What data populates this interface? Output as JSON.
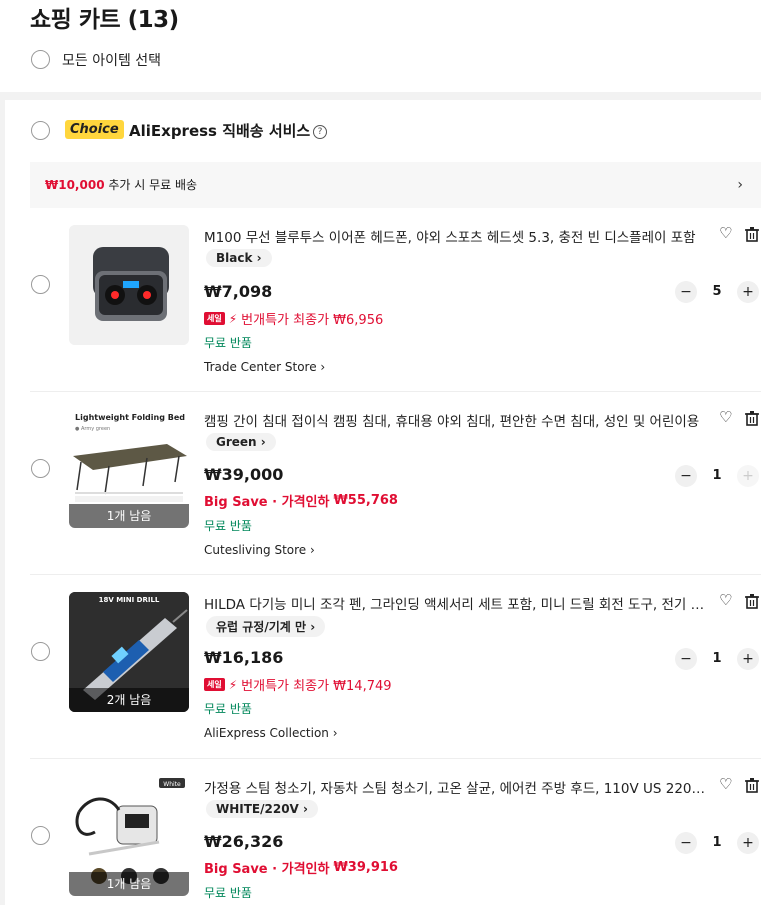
{
  "header": {
    "title": "쇼핑 카트 (13)",
    "select_all_label": "모든 아이템 선택"
  },
  "store": {
    "choice_badge": "Choice",
    "title": "AliExpress 직배송 서비스",
    "info_icon": "?",
    "shipping_amount": "₩10,000",
    "shipping_text": " 추가 시 무료 배송",
    "shipping_chevron": "›"
  },
  "items": [
    {
      "title": "M100 무선 블루투스 이어폰 헤드폰, 야외 스포츠 헤드셋 5.3, 충전 빈 디스플레이 포함",
      "variant": "Black ›",
      "price": "₩7,098",
      "promo_tag": "세일",
      "promo_text": "번개특가 최종가 ",
      "promo_price": "₩6,956",
      "free_return": "무료 반품",
      "store": "Trade Center Store ›",
      "qty": "5",
      "remaining": ""
    },
    {
      "title": "캠핑 간이 침대 접이식 캠핑 침대, 휴대용 야외 침대, 편안한 수면 침대, 성인 및 어린이용",
      "variant": "Green ›",
      "price": "₩39,000",
      "promo_text": "Big Save · 가격인하 ",
      "promo_price": "₩55,768",
      "free_return": "무료 반품",
      "store": "Cutesliving Store ›",
      "qty": "1",
      "remaining": "1개 남음",
      "thumb_caption": "Lightweight Folding Bed",
      "thumb_sub": "● Army green"
    },
    {
      "title": "HILDA 다기능 미니 조각 펜, 그라인딩 액세서리 세트 포함, 미니 드릴 회전 도구, 전기 조각기",
      "variant": "유럽 규정/기계 만 ›",
      "price": "₩16,186",
      "promo_tag": "세일",
      "promo_text": "번개특가 최종가 ",
      "promo_price": "₩14,749",
      "free_return": "무료 반품",
      "store": "AliExpress Collection ›",
      "qty": "1",
      "remaining": "2개 남음",
      "thumb_caption": "18V MINI DRILL"
    },
    {
      "title": "가정용 스팀 청소기, 자동차 스팀 청소기, 고온 살균, 에어컨 주방 후드, 110V US 220V EU",
      "variant": "WHITE/220V ›",
      "price": "₩26,326",
      "promo_text": "Big Save · 가격인하 ",
      "promo_price": "₩39,916",
      "free_return": "무료 반품",
      "store": "",
      "qty": "1",
      "remaining": "1개 남음",
      "thumb_caption": "White"
    }
  ],
  "icons": {
    "heart": "♡",
    "minus": "−",
    "plus": "+"
  },
  "colors": {
    "accent_red": "#e00e33",
    "free_return_green": "#00875a",
    "choice_yellow": "#ffd63d"
  }
}
